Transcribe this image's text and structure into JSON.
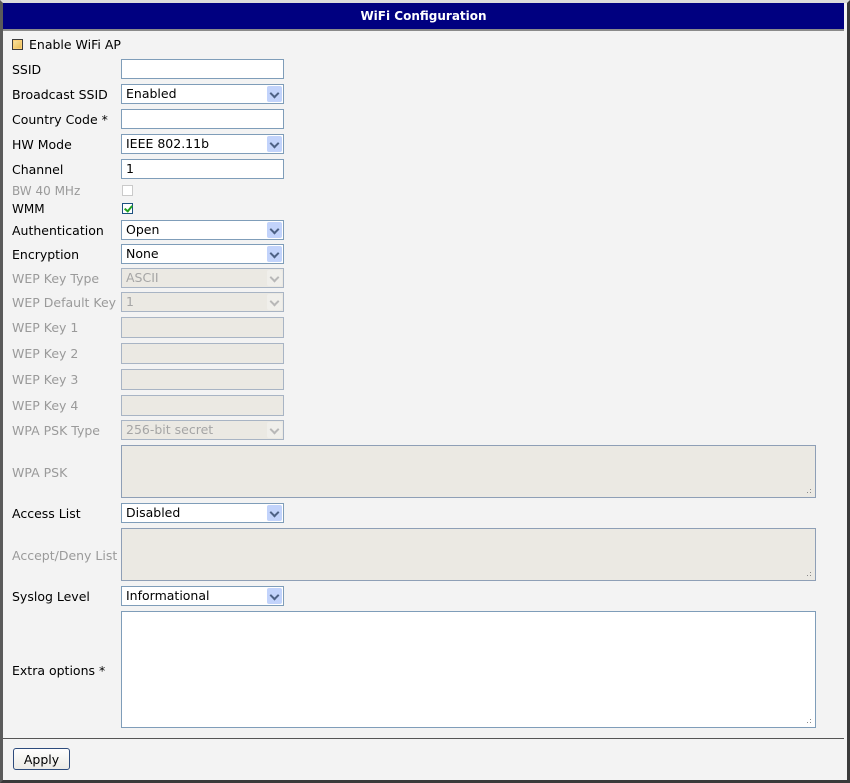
{
  "header": {
    "title": "WiFi Configuration"
  },
  "colors": {
    "header_bg": "#000080",
    "body_bg": "#f3f3f3",
    "disabled_field": "#ebe9e3",
    "field_border": "#7f9db9"
  },
  "form": {
    "enable_wifi_ap": {
      "label": "Enable WiFi AP",
      "checked": false
    },
    "ssid": {
      "label": "SSID",
      "value": ""
    },
    "broadcast_ssid": {
      "label": "Broadcast SSID",
      "value": "Enabled"
    },
    "country_code": {
      "label": "Country Code *",
      "value": ""
    },
    "hw_mode": {
      "label": "HW Mode",
      "value": "IEEE 802.11b"
    },
    "channel": {
      "label": "Channel",
      "value": "1"
    },
    "bw_40mhz": {
      "label": "BW 40 MHz",
      "checked": false,
      "disabled": true
    },
    "wmm": {
      "label": "WMM",
      "checked": true
    },
    "authentication": {
      "label": "Authentication",
      "value": "Open"
    },
    "encryption": {
      "label": "Encryption",
      "value": "None"
    },
    "wep_key_type": {
      "label": "WEP Key Type",
      "value": "ASCII",
      "disabled": true
    },
    "wep_default_key": {
      "label": "WEP Default Key",
      "value": "1",
      "disabled": true
    },
    "wep_key_1": {
      "label": "WEP Key 1",
      "value": "",
      "disabled": true
    },
    "wep_key_2": {
      "label": "WEP Key 2",
      "value": "",
      "disabled": true
    },
    "wep_key_3": {
      "label": "WEP Key 3",
      "value": "",
      "disabled": true
    },
    "wep_key_4": {
      "label": "WEP Key 4",
      "value": "",
      "disabled": true
    },
    "wpa_psk_type": {
      "label": "WPA PSK Type",
      "value": "256-bit secret",
      "disabled": true
    },
    "wpa_psk": {
      "label": "WPA PSK",
      "value": "",
      "disabled": true
    },
    "access_list": {
      "label": "Access List",
      "value": "Disabled"
    },
    "accept_deny_list": {
      "label": "Accept/Deny List",
      "value": "",
      "disabled": true
    },
    "syslog_level": {
      "label": "Syslog Level",
      "value": "Informational"
    },
    "extra_options": {
      "label": "Extra options *",
      "value": ""
    }
  },
  "buttons": {
    "apply": "Apply"
  }
}
